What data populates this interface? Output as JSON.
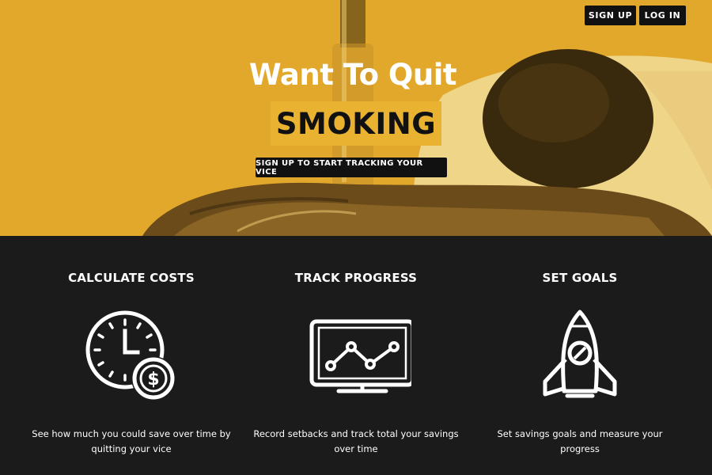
{
  "nav": {
    "signup_label": "SIGN UP",
    "login_label": "LOG IN"
  },
  "hero": {
    "title": "Want To Quit",
    "highlight": "SMOKING",
    "cta_label": "SIGN UP TO START TRACKING YOUR VICE",
    "accent_color": "#e6ac2e"
  },
  "features": [
    {
      "title": "CALCULATE COSTS",
      "icon": "clock-dollar-icon",
      "description": "See how much you could save over time by quitting your vice"
    },
    {
      "title": "TRACK PROGRESS",
      "icon": "monitor-chart-icon",
      "description": "Record setbacks and track total your savings over time"
    },
    {
      "title": "SET GOALS",
      "icon": "rocket-icon",
      "description": "Set savings goals and measure your progress"
    }
  ]
}
